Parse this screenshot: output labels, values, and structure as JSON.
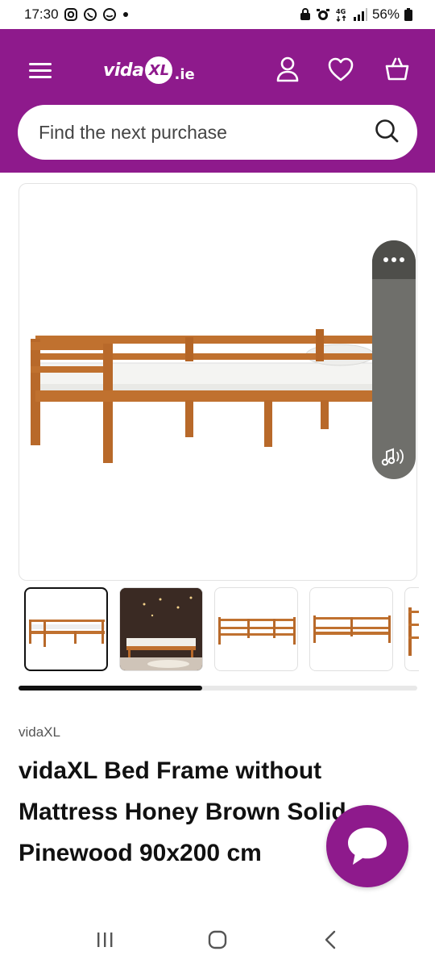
{
  "status_bar": {
    "time": "17:30",
    "notification_icons": [
      "instagram-icon",
      "whatsapp-icon",
      "smiley-icon",
      "dot-icon"
    ],
    "system_icons": [
      "lock-icon",
      "alarm-icon",
      "4g-icon",
      "signal-icon"
    ],
    "battery": "56%"
  },
  "header": {
    "logo_text": "vida",
    "logo_badge": "XL",
    "logo_tld": ".ie",
    "background": "#8e1a8c",
    "search": {
      "placeholder": "Find the next purchase"
    }
  },
  "product": {
    "brand": "vidaXL",
    "title": "vidaXL Bed Frame without Mattress Honey Brown Solid Pinewood 90x200 cm",
    "gallery": {
      "thumbnails": [
        {
          "name": "bed-side-view",
          "active": true
        },
        {
          "name": "bed-room-scene",
          "active": false
        },
        {
          "name": "bed-frame-front",
          "active": false
        },
        {
          "name": "bed-frame-angle",
          "active": false
        },
        {
          "name": "bed-frame-end",
          "active": false
        }
      ],
      "scroll_progress": 0.46
    }
  },
  "colors": {
    "brand_purple": "#8e1a8c",
    "wood": "#c0712f",
    "panel_gray": "#6f6f6b"
  }
}
